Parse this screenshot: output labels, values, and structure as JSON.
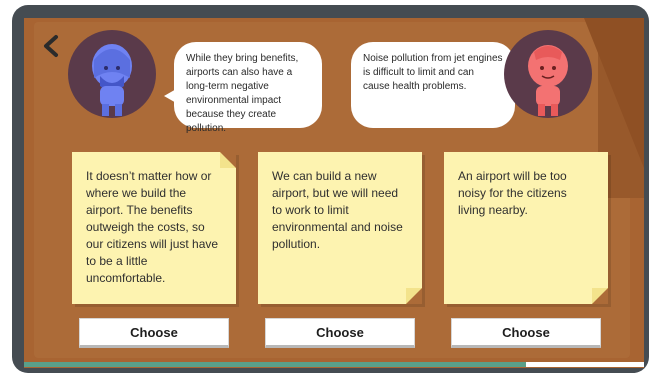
{
  "speakers": [
    {
      "color": "#6a7df0",
      "speech": "While they bring benefits, airports can also have a long-term negative environmental impact because they create pollution."
    },
    {
      "color": "#f26a6a",
      "speech": "Noise pollution from jet engines is difficult to limit and can cause health problems."
    }
  ],
  "options": [
    {
      "text": "It doesn’t matter how or where we build the airport. The benefits outweigh the costs, so our citizens will just have to be a little uncomfortable.",
      "button": "Choose"
    },
    {
      "text": "We can build a new airport, but we will need to work to limit environmental and noise pollution.",
      "button": "Choose"
    },
    {
      "text": "An airport will be too noisy for the citizens living nearby.",
      "button": "Choose"
    }
  ],
  "progress": 0.81,
  "colors": {
    "board": "#ac6b38",
    "note": "#fdf3b0",
    "progress": "#5aa08a"
  }
}
